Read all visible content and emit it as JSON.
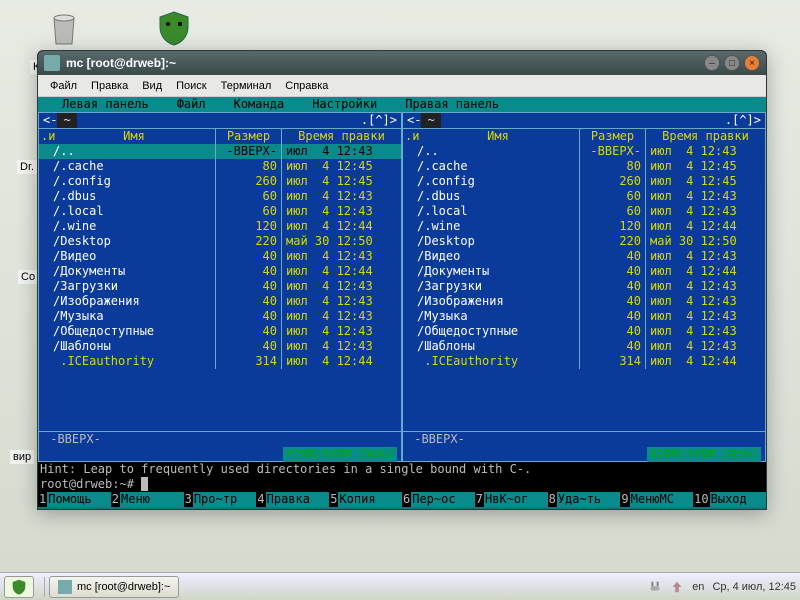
{
  "desktop": {
    "icon_labels": {
      "korz": "Ко",
      "drw": "Dr.",
      "comp": "Со",
      "vir": "вир"
    }
  },
  "window": {
    "title": "mc [root@drweb]:~",
    "menubar": [
      "Файл",
      "Правка",
      "Вид",
      "Поиск",
      "Терминал",
      "Справка"
    ]
  },
  "mc": {
    "menubar": [
      "Левая панель",
      "Файл",
      "Команда",
      "Настройки",
      "Правая панель"
    ],
    "panel_path_prefix": "<-",
    "panel_path": "~",
    "panel_path_suffix": ".[^]>",
    "cols": {
      "i": ".и",
      "name": "Имя",
      "size": "Размер",
      "date": "Время правки"
    },
    "rows": [
      {
        "name": "/..",
        "size": "-ВВЕРХ-",
        "date": "июл  4 12:43",
        "dir": true,
        "selL": true
      },
      {
        "name": "/.cache",
        "size": "80",
        "date": "июл  4 12:45",
        "dir": true
      },
      {
        "name": "/.config",
        "size": "260",
        "date": "июл  4 12:45",
        "dir": true
      },
      {
        "name": "/.dbus",
        "size": "60",
        "date": "июл  4 12:43",
        "dir": true
      },
      {
        "name": "/.local",
        "size": "60",
        "date": "июл  4 12:43",
        "dir": true
      },
      {
        "name": "/.wine",
        "size": "120",
        "date": "июл  4 12:44",
        "dir": true
      },
      {
        "name": "/Desktop",
        "size": "220",
        "date": "май 30 12:50",
        "dir": true
      },
      {
        "name": "/Видео",
        "size": "40",
        "date": "июл  4 12:43",
        "dir": true
      },
      {
        "name": "/Документы",
        "size": "40",
        "date": "июл  4 12:44",
        "dir": true
      },
      {
        "name": "/Загрузки",
        "size": "40",
        "date": "июл  4 12:43",
        "dir": true
      },
      {
        "name": "/Изображения",
        "size": "40",
        "date": "июл  4 12:43",
        "dir": true
      },
      {
        "name": "/Музыка",
        "size": "40",
        "date": "июл  4 12:43",
        "dir": true
      },
      {
        "name": "/Общедоступные",
        "size": "40",
        "date": "июл  4 12:43",
        "dir": true
      },
      {
        "name": "/Шаблоны",
        "size": "40",
        "date": "июл  4 12:43",
        "dir": true
      },
      {
        "name": " .ICEauthority",
        "size": "314",
        "date": "июл  4 12:44",
        "dir": false
      }
    ],
    "status_name": "-ВВЕРХ-",
    "status_usage": "429M/449M (95%)",
    "hint": "Hint: Leap to frequently used directories in a single bound with C-.",
    "prompt": "root@drweb:~#",
    "fkeys": [
      {
        "n": "1",
        "l": "Помощь"
      },
      {
        "n": "2",
        "l": "Меню"
      },
      {
        "n": "3",
        "l": "Про~тр"
      },
      {
        "n": "4",
        "l": "Правка"
      },
      {
        "n": "5",
        "l": "Копия"
      },
      {
        "n": "6",
        "l": "Пер~ос"
      },
      {
        "n": "7",
        "l": "НвК~ог"
      },
      {
        "n": "8",
        "l": "Уда~ть"
      },
      {
        "n": "9",
        "l": "МенюMC"
      },
      {
        "n": "10",
        "l": "Выход"
      }
    ]
  },
  "taskbar": {
    "task_label": "mc [root@drweb]:~",
    "lang": "en",
    "date": "Ср,  4 июл, 12:45"
  }
}
